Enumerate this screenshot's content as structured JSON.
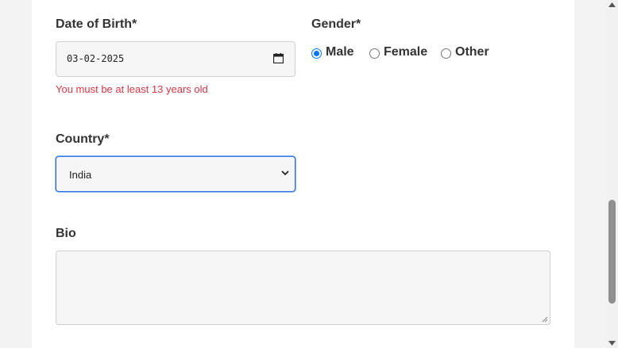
{
  "form": {
    "dob": {
      "label": "Date of Birth*",
      "value": "03-02-2025",
      "error": "You must be at least 13 years old"
    },
    "gender": {
      "label": "Gender*",
      "options": [
        "Male",
        "Female",
        "Other"
      ],
      "selected": "Male"
    },
    "country": {
      "label": "Country*",
      "value": "India"
    },
    "bio": {
      "label": "Bio",
      "value": ""
    }
  },
  "icons": [
    "calendar-icon",
    "chevron-down-icon",
    "resize-grip-icon",
    "scroll-up-icon",
    "scroll-down-icon"
  ],
  "colors": {
    "accent": "#0075ff",
    "error": "#dc3545",
    "focus": "#2f6fdf"
  }
}
